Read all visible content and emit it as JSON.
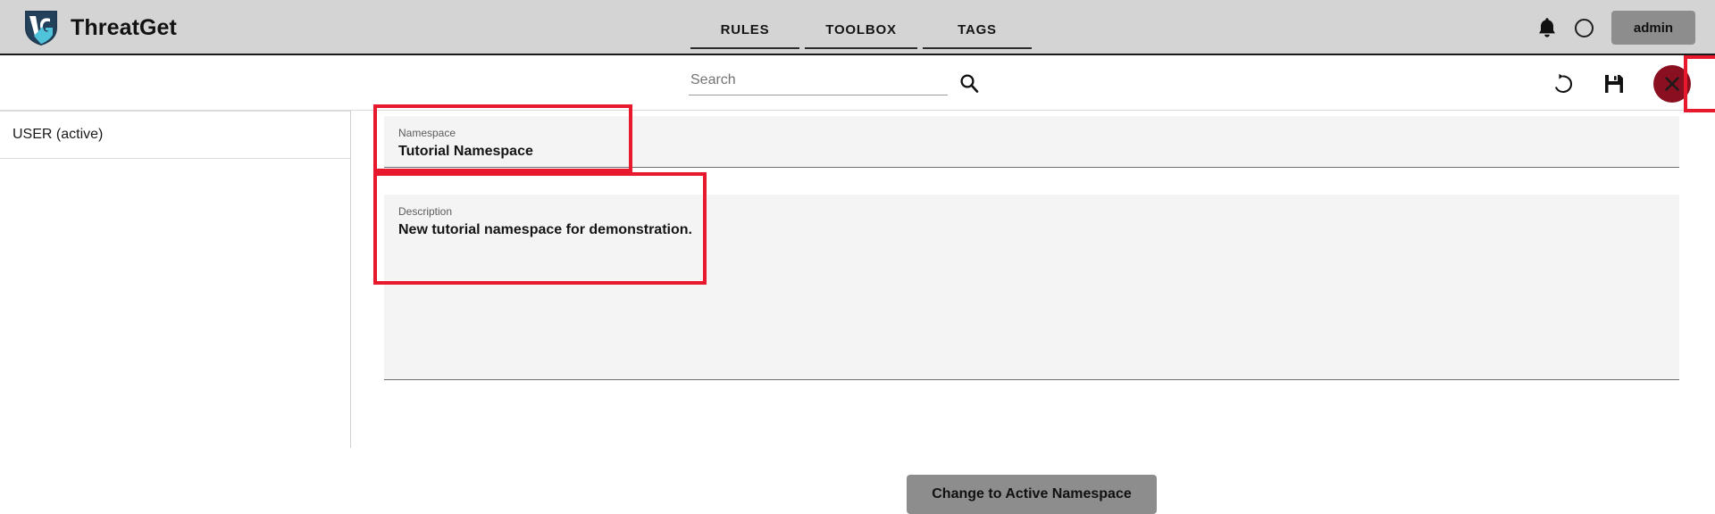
{
  "header": {
    "brand_title": "ThreatGet",
    "logo_icon": "threatget-shield-logo",
    "nav_tabs": [
      {
        "label": "RULES",
        "icon": ""
      },
      {
        "label": "TOOLBOX",
        "icon": ""
      },
      {
        "label": "TAGS",
        "icon": ""
      }
    ],
    "notification_icon": "bell-icon",
    "avatar_icon": "avatar-circle-icon",
    "user_label": "admin"
  },
  "toolbar": {
    "search_placeholder": "Search",
    "search_value": "",
    "search_icon": "magnifier-icon",
    "reset_icon": "undo-refresh-icon",
    "save_icon": "floppy-disk-save-icon",
    "close_icon": "close-x-icon"
  },
  "sidebar": {
    "items": [
      {
        "label": "USER (active)"
      }
    ]
  },
  "main": {
    "fields": [
      {
        "label": "Namespace",
        "value": "Tutorial Namespace"
      },
      {
        "label": "Description",
        "value": "New tutorial namespace for demonstration."
      }
    ],
    "cta_label": "Change to Active Namespace"
  },
  "annotations": {
    "highlight_color": "#e8192c",
    "boxes": [
      "namespace-field",
      "description-field",
      "close-button"
    ]
  },
  "colors": {
    "header_bg": "#d4d4d4",
    "field_bg": "#f4f4f4",
    "button_gray": "#8d8d8d",
    "close_red": "#8a0f20",
    "accent_cyan": "#4ec3d9",
    "highlight_red": "#e8192c"
  }
}
